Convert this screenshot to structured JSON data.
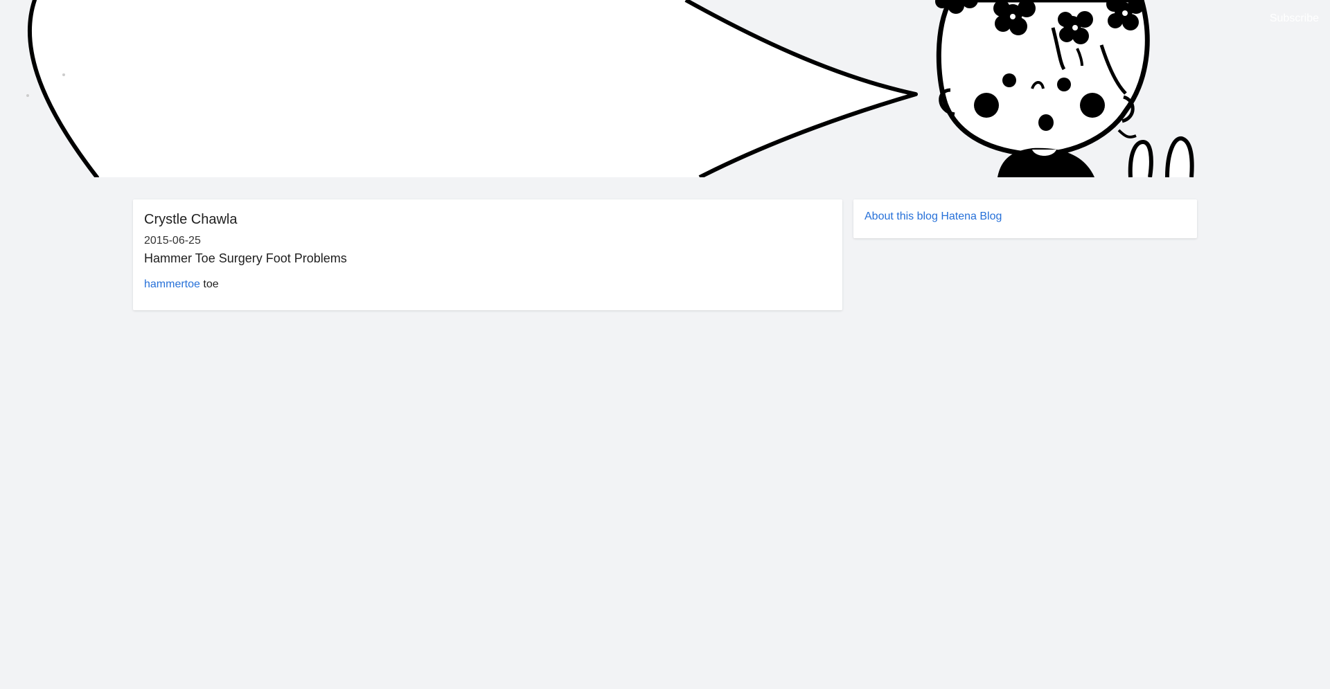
{
  "header": {
    "subscribe_label": "Subscribe"
  },
  "entry": {
    "author": "Crystle Chawla",
    "date": "2015-06-25",
    "title": "Hammer Toe Surgery Foot Problems",
    "tag_link": "hammertoe",
    "tag_text": "toe"
  },
  "sidebar": {
    "about_link": "About this blog",
    "hatena_link": "Hatena Blog"
  },
  "colors": {
    "background": "#f2f3f5",
    "link": "#2670d8",
    "card": "#ffffff"
  }
}
